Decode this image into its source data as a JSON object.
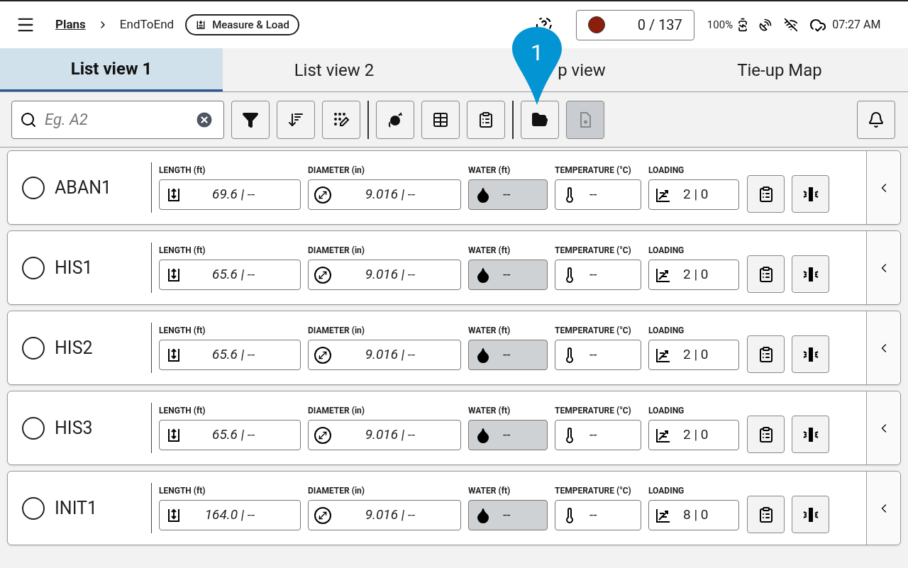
{
  "header": {
    "breadcrumb": [
      {
        "label": "Plans",
        "kind": "link"
      },
      {
        "label": "EndToEnd",
        "kind": "text"
      }
    ],
    "mode_chip": "Measure & Load",
    "record": {
      "color": "#8b1e0c",
      "count": "0 / 137"
    },
    "battery": "100%",
    "time": "07:27 AM"
  },
  "tabs": [
    {
      "label": "List view 1",
      "selected": true
    },
    {
      "label": "List view 2",
      "selected": false
    },
    {
      "label": "p view",
      "selected": false
    },
    {
      "label": "Tie-up Map",
      "selected": false
    }
  ],
  "callout": "1",
  "search": {
    "placeholder": "Eg. A2"
  },
  "toolbar": [
    {
      "kind": "filter",
      "disabled": false
    },
    {
      "kind": "sort",
      "disabled": false
    },
    {
      "kind": "dots-edit",
      "disabled": false
    },
    {
      "kind": "separator"
    },
    {
      "kind": "ball",
      "disabled": false
    },
    {
      "kind": "table",
      "disabled": false
    },
    {
      "kind": "clipboard",
      "disabled": false
    },
    {
      "kind": "separator"
    },
    {
      "kind": "folder",
      "disabled": false
    },
    {
      "kind": "file-eye",
      "disabled": true
    }
  ],
  "rows": [
    {
      "name": "ABAN1",
      "selected": false,
      "fields": [
        {
          "kind": "length",
          "label": "LENGTH (ft)",
          "value": "69.6 | --",
          "disabled": false
        },
        {
          "kind": "diameter",
          "label": "DIAMETER (in)",
          "value": "9.016 | --",
          "disabled": false
        },
        {
          "kind": "water",
          "label": "WATER (ft)",
          "value": "--",
          "disabled": true
        },
        {
          "kind": "temperature",
          "label": "TEMPERATURE (°C)",
          "value": "--",
          "disabled": false
        },
        {
          "kind": "loading",
          "label": "LOADING",
          "value": "2 | 0",
          "disabled": false
        }
      ]
    },
    {
      "name": "HIS1",
      "selected": false,
      "fields": [
        {
          "kind": "length",
          "label": "LENGTH (ft)",
          "value": "65.6 | --",
          "disabled": false
        },
        {
          "kind": "diameter",
          "label": "DIAMETER (in)",
          "value": "9.016 | --",
          "disabled": false
        },
        {
          "kind": "water",
          "label": "WATER (ft)",
          "value": "--",
          "disabled": true
        },
        {
          "kind": "temperature",
          "label": "TEMPERATURE (°C)",
          "value": "--",
          "disabled": false
        },
        {
          "kind": "loading",
          "label": "LOADING",
          "value": "2 | 0",
          "disabled": false
        }
      ]
    },
    {
      "name": "HIS2",
      "selected": false,
      "fields": [
        {
          "kind": "length",
          "label": "LENGTH (ft)",
          "value": "65.6 | --",
          "disabled": false
        },
        {
          "kind": "diameter",
          "label": "DIAMETER (in)",
          "value": "9.016 | --",
          "disabled": false
        },
        {
          "kind": "water",
          "label": "WATER (ft)",
          "value": "--",
          "disabled": true
        },
        {
          "kind": "temperature",
          "label": "TEMPERATURE (°C)",
          "value": "--",
          "disabled": false
        },
        {
          "kind": "loading",
          "label": "LOADING",
          "value": "2 | 0",
          "disabled": false
        }
      ]
    },
    {
      "name": "HIS3",
      "selected": false,
      "fields": [
        {
          "kind": "length",
          "label": "LENGTH (ft)",
          "value": "65.6 | --",
          "disabled": false
        },
        {
          "kind": "diameter",
          "label": "DIAMETER (in)",
          "value": "9.016 | --",
          "disabled": false
        },
        {
          "kind": "water",
          "label": "WATER (ft)",
          "value": "--",
          "disabled": true
        },
        {
          "kind": "temperature",
          "label": "TEMPERATURE (°C)",
          "value": "--",
          "disabled": false
        },
        {
          "kind": "loading",
          "label": "LOADING",
          "value": "2 | 0",
          "disabled": false
        }
      ]
    },
    {
      "name": "INIT1",
      "selected": false,
      "fields": [
        {
          "kind": "length",
          "label": "LENGTH (ft)",
          "value": "164.0 | --",
          "disabled": false
        },
        {
          "kind": "diameter",
          "label": "DIAMETER (in)",
          "value": "9.016 | --",
          "disabled": false
        },
        {
          "kind": "water",
          "label": "WATER (ft)",
          "value": "--",
          "disabled": true
        },
        {
          "kind": "temperature",
          "label": "TEMPERATURE (°C)",
          "value": "--",
          "disabled": false
        },
        {
          "kind": "loading",
          "label": "LOADING",
          "value": "8 | 0",
          "disabled": false
        }
      ]
    }
  ]
}
